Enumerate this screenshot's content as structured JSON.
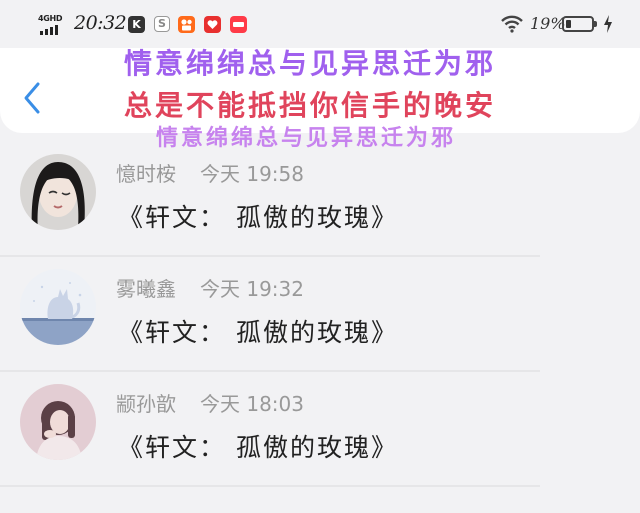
{
  "status_bar": {
    "network": "4GHD",
    "time": "20:32",
    "battery_percent": "19%",
    "battery_level": 0.19,
    "app_icons": [
      {
        "icon": "k-app-icon",
        "glyph": "K",
        "color": "#333333"
      },
      {
        "icon": "s-app-icon",
        "glyph": "S",
        "color": "#9a9a9a"
      },
      {
        "icon": "kuaishou-icon",
        "glyph": "",
        "color": "#ff6a1a"
      },
      {
        "icon": "red-app-icon",
        "glyph": "",
        "color": "#e8302f"
      },
      {
        "icon": "xiaohongshu-icon",
        "glyph": "",
        "color": "#ff3b48"
      }
    ]
  },
  "header": {
    "overlay_line1": "情意绵绵总与见异思迁为邪",
    "overlay_line2": "总是不能抵挡你信手的晚安",
    "overlay_line3": "情意绵绵总与见异思迁为邪"
  },
  "messages": [
    {
      "name": "憶时桉",
      "time": "今天 19:58",
      "text": "《轩文： 孤傲的玫瑰》"
    },
    {
      "name": "雾曦鑫",
      "time": "今天 19:32",
      "text": "《轩文： 孤傲的玫瑰》"
    },
    {
      "name": "颛孙歆",
      "time": "今天 18:03",
      "text": "《轩文： 孤傲的玫瑰》"
    }
  ]
}
